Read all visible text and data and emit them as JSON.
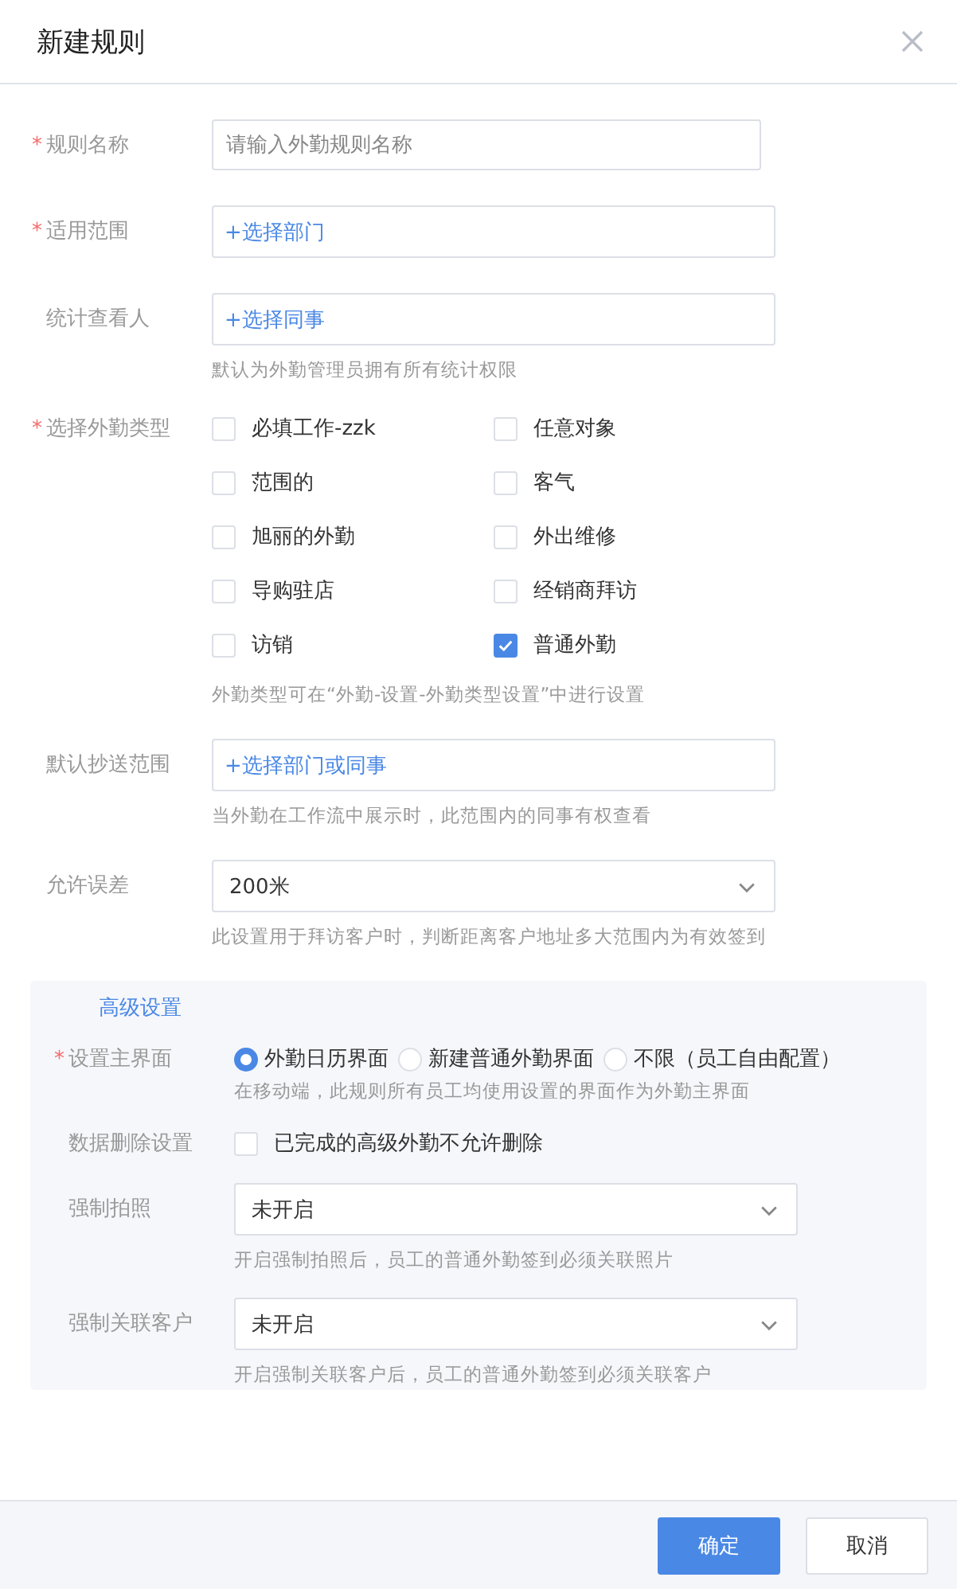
{
  "dialog": {
    "title": "新建规则"
  },
  "fields": [
    {
      "kind": "input",
      "label": "规则名称",
      "asterisk": "*",
      "placeholder": "请输入外勤规则名称"
    },
    {
      "kind": "picker",
      "label": "适用范围",
      "asterisk": "*",
      "action": "+选择部门"
    },
    {
      "kind": "picker",
      "label": "统计查看人",
      "action": "+选择同事",
      "hint": "默认为外勤管理员拥有所有统计权限"
    },
    {
      "kind": "checkboxes",
      "label": "选择外勤类型",
      "asterisk": "*",
      "options": [
        {
          "label": "必填工作-zzk",
          "checked": false
        },
        {
          "label": "任意对象",
          "checked": false
        },
        {
          "label": "范围的",
          "checked": false
        },
        {
          "label": "客气",
          "checked": false
        },
        {
          "label": "旭丽的外勤",
          "checked": false
        },
        {
          "label": "外出维修",
          "checked": false
        },
        {
          "label": "导购驻店",
          "checked": false
        },
        {
          "label": "经销商拜访",
          "checked": false
        },
        {
          "label": "访销",
          "checked": false
        },
        {
          "label": "普通外勤",
          "checked": true
        }
      ],
      "hint": "外勤类型可在“外勤-设置-外勤类型设置”中进行设置"
    },
    {
      "kind": "picker",
      "label": "默认抄送范围",
      "action": "+选择部门或同事",
      "hint": "当外勤在工作流中展示时，此范围内的同事有权查看"
    },
    {
      "kind": "select",
      "label": "允许误差",
      "value": "200米",
      "hint": "此设置用于拜访客户时，判断距离客户地址多大范围内为有效签到"
    }
  ],
  "advanced": {
    "title": "高级设置",
    "fields": [
      {
        "kind": "radios",
        "label": "设置主界面",
        "asterisk": "*",
        "options": [
          {
            "label": "外勤日历界面",
            "selected": true
          },
          {
            "label": "新建普通外勤界面",
            "selected": false
          },
          {
            "label": "不限（员工自由配置）",
            "selected": false
          }
        ],
        "hint": "在移动端，此规则所有员工均使用设置的界面作为外勤主界面"
      },
      {
        "kind": "checkbox",
        "label": "数据删除设置",
        "option": {
          "label": "已完成的高级外勤不允许删除",
          "checked": false
        }
      },
      {
        "kind": "select",
        "label": "强制拍照",
        "value": "未开启",
        "hint": "开启强制拍照后，员工的普通外勤签到必须关联照片"
      },
      {
        "kind": "select",
        "label": "强制关联客户",
        "value": "未开启",
        "hint": "开启强制关联客户后，员工的普通外勤签到必须关联客户"
      }
    ]
  },
  "buttons": [
    {
      "label": "确定",
      "kind": "primary"
    },
    {
      "label": "取消",
      "kind": "default"
    }
  ]
}
